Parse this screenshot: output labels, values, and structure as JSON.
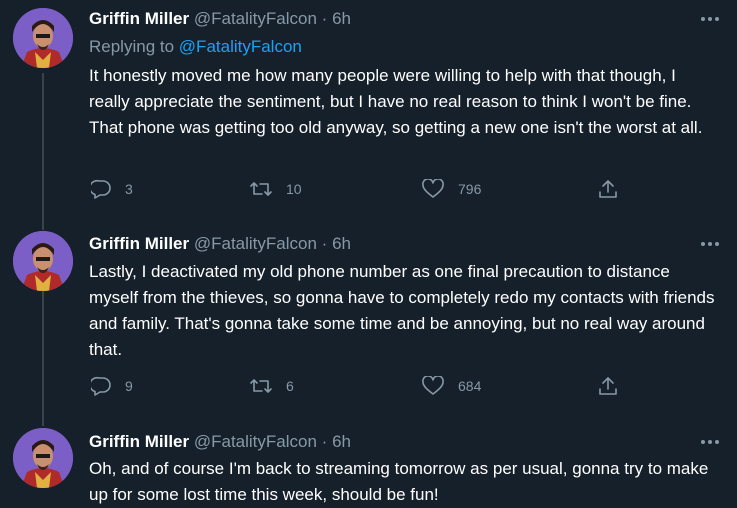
{
  "colors": {
    "background": "#15202b",
    "text_primary": "#ffffff",
    "text_secondary": "#8899a6",
    "link": "#1da1f2",
    "divider": "#38444d"
  },
  "tweets": [
    {
      "name": "Griffin Miller",
      "handle": "@FatalityFalcon",
      "separator": "·",
      "time": "6h",
      "replying_prefix": "Replying to",
      "replying_mention": "@FatalityFalcon",
      "text": "It honestly moved me how many people were willing to help with that though, I really appreciate the sentiment, but I have no real reason to think I won't be fine. That phone was getting too old anyway, so getting a new one isn't the worst at all.",
      "replies": "3",
      "retweets": "10",
      "likes": "796",
      "icons": [
        "reply-icon",
        "retweet-icon",
        "like-icon",
        "share-icon",
        "more-icon"
      ]
    },
    {
      "name": "Griffin Miller",
      "handle": "@FatalityFalcon",
      "separator": "·",
      "time": "6h",
      "text": "Lastly, I deactivated my old phone number as one final precaution to distance myself from the thieves, so gonna have to completely redo my contacts with friends and family. That's gonna take some time and be annoying, but no real way around that.",
      "replies": "9",
      "retweets": "6",
      "likes": "684",
      "icons": [
        "reply-icon",
        "retweet-icon",
        "like-icon",
        "share-icon",
        "more-icon"
      ]
    },
    {
      "name": "Griffin Miller",
      "handle": "@FatalityFalcon",
      "separator": "·",
      "time": "6h",
      "text": "Oh, and of course I'm back to streaming tomorrow as per usual, gonna try to make up for some lost time this week, should be fun!",
      "icons": [
        "more-icon"
      ]
    }
  ]
}
